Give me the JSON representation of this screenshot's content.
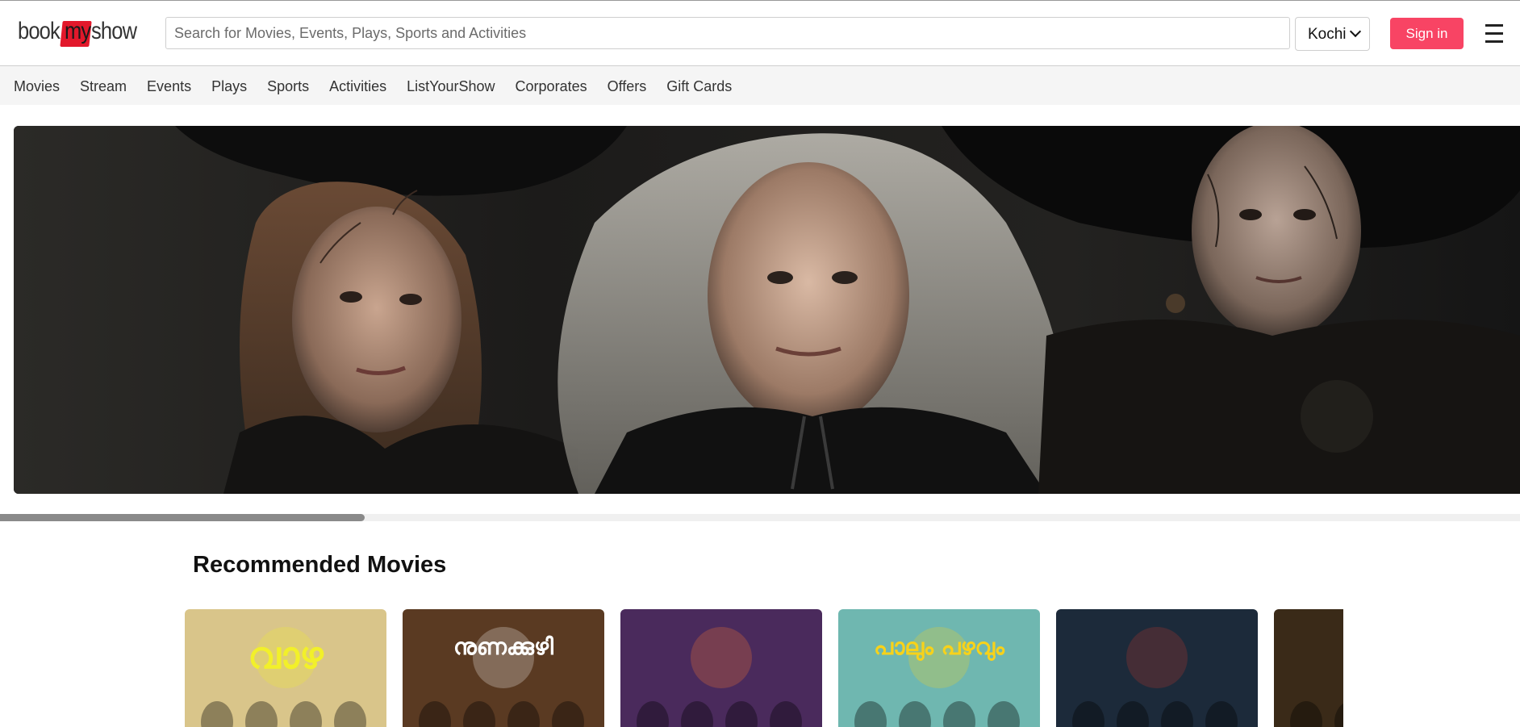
{
  "header": {
    "logo": {
      "part1": "book",
      "part2": "my",
      "part3": "show"
    },
    "search": {
      "placeholder": "Search for Movies, Events, Plays, Sports and Activities",
      "value": ""
    },
    "city": {
      "selected": "Kochi"
    },
    "sign_in_label": "Sign in",
    "menu_icon": "hamburger-menu-icon"
  },
  "nav": {
    "items": [
      "Movies",
      "Stream",
      "Events",
      "Plays",
      "Sports",
      "Activities",
      "ListYourShow",
      "Corporates",
      "Offers",
      "Gift Cards"
    ]
  },
  "banner": {
    "image": "three-witches-banner"
  },
  "carousel": {
    "progress": 0.24
  },
  "recommended": {
    "title": "Recommended Movies",
    "posters": [
      {
        "title_text": "വാഴ",
        "bg": "#d9c58a",
        "accent": "#f2f02a"
      },
      {
        "title_text": "നുണക്കുഴി",
        "bg": "#5a3a22",
        "accent": "#ffffff"
      },
      {
        "title_text": "",
        "bg": "#4a2a5c",
        "accent": "#ff7a2a"
      },
      {
        "title_text": "പാലും പഴവും",
        "bg": "#6fb7b0",
        "accent": "#f7d21a"
      },
      {
        "title_text": "",
        "bg": "#1c2a3a",
        "accent": "#c0392b"
      },
      {
        "title_text": "",
        "bg": "#3a2a18",
        "accent": "#c89a4a"
      }
    ]
  }
}
